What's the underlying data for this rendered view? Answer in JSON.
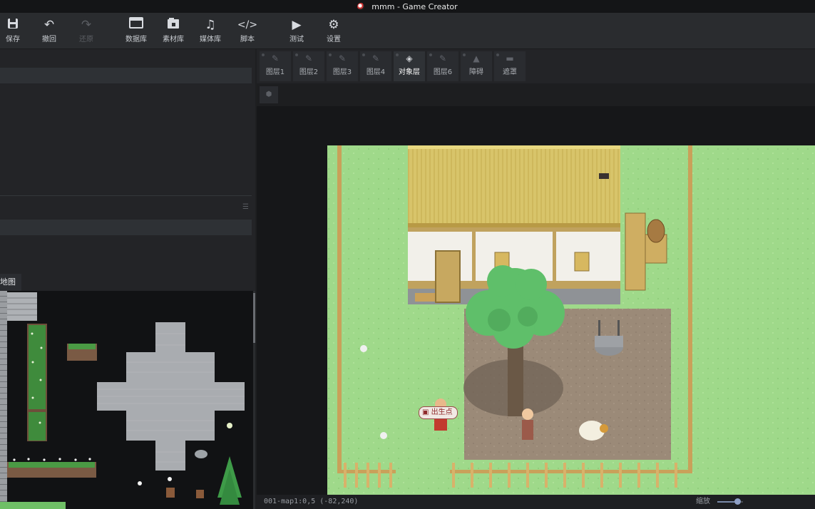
{
  "window": {
    "title": "mmm - Game Creator"
  },
  "toolbar": {
    "save": "保存",
    "undo": "撤回",
    "redo": "还原",
    "database": "数据库",
    "assets": "素材库",
    "media": "媒体库",
    "script": "脚本",
    "test": "测试",
    "settings": "设置"
  },
  "left_panel": {
    "tileset_tab": "地图"
  },
  "layers": [
    {
      "label": "图层1"
    },
    {
      "label": "图层2"
    },
    {
      "label": "图层3"
    },
    {
      "label": "图层4"
    },
    {
      "label": "对象层"
    },
    {
      "label": "图层6"
    },
    {
      "label": "障碍"
    },
    {
      "label": "遮罩"
    }
  ],
  "map": {
    "spawn_label": "出生点"
  },
  "status": {
    "position": "001-map1:0,5 (-82,240)",
    "zoom_label": "缩放",
    "zoom_level": 0.67
  },
  "colors": {
    "grass": "#9fd98a",
    "dirt": "#9b8a78",
    "roof": "#d8c46a",
    "accent": "#8fa0c6"
  }
}
